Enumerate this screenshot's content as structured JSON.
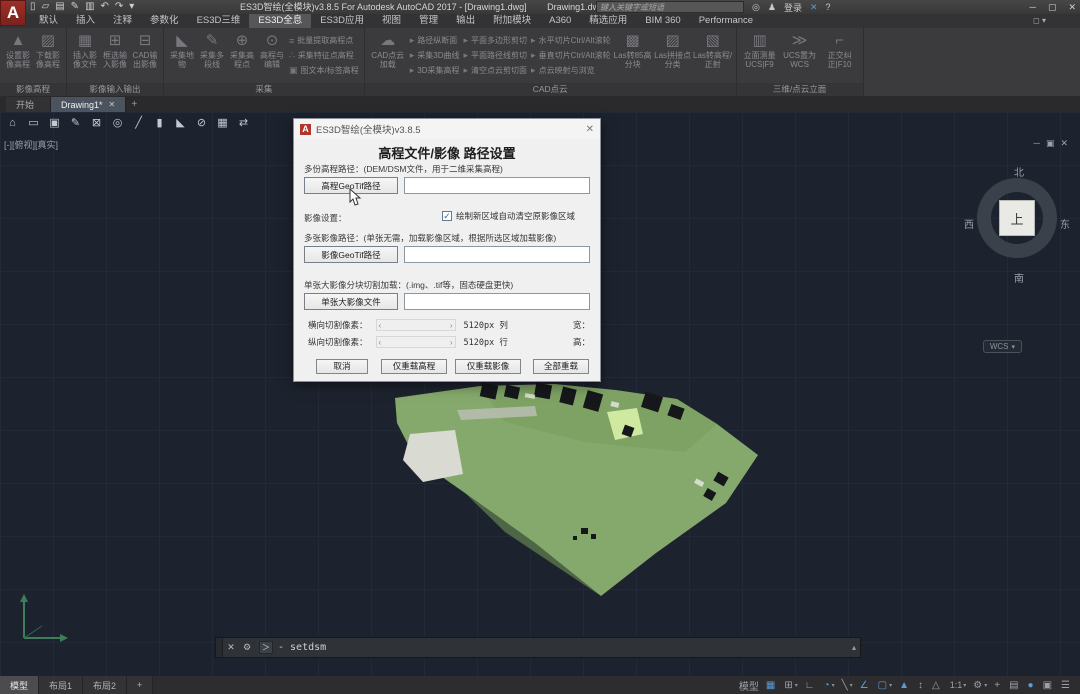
{
  "colors": {
    "canvas_bg": "#1d232e",
    "titlebar_bg": "#3a3a3c",
    "active_status": "#5b9bd8",
    "autocad_red": "#b2362c",
    "dialog_bg": "#f0f0f0"
  },
  "titlebar": {
    "app_title": "ES3D智绘(全模块)v3.8.5 For Autodesk AutoCAD 2017 - [Drawing1.dwg]",
    "doc_title": "Drawing1.dwg",
    "search_placeholder": "键入关键字或短语",
    "signin_label": "登录",
    "binoculars_glyph": "◎",
    "user_glyph": "♟",
    "exchange_glyph": "✕",
    "help_glyph": "?",
    "win_min": "─",
    "win_max": "▢",
    "win_close": "✕",
    "qat_icons": [
      {
        "name": "new-icon",
        "glyph": "▯"
      },
      {
        "name": "open-icon",
        "glyph": "▱"
      },
      {
        "name": "save-icon",
        "glyph": "▤"
      },
      {
        "name": "save-as-icon",
        "glyph": "✎"
      },
      {
        "name": "plot-icon",
        "glyph": "▥"
      },
      {
        "name": "undo-icon",
        "glyph": "↶"
      },
      {
        "name": "redo-icon",
        "glyph": "↷"
      },
      {
        "name": "qat-dropdown-icon",
        "glyph": "▾"
      }
    ]
  },
  "ribbon_tabs": {
    "items": [
      {
        "label": "默认"
      },
      {
        "label": "插入"
      },
      {
        "label": "注释"
      },
      {
        "label": "参数化"
      },
      {
        "label": "ES3D三维"
      },
      {
        "label": "ES3D全息",
        "active": true
      },
      {
        "label": "ES3D应用"
      },
      {
        "label": "视图"
      },
      {
        "label": "管理"
      },
      {
        "label": "输出"
      },
      {
        "label": "附加模块"
      },
      {
        "label": "A360"
      },
      {
        "label": "精选应用"
      },
      {
        "label": "BIM 360"
      },
      {
        "label": "Performance"
      }
    ],
    "toggle_glyph": "◻ ▾"
  },
  "ribbon": {
    "p1": {
      "label": "影像高程",
      "big": [
        {
          "name": "set-image-elevation",
          "glyph": "▲",
          "label": "设置影像高程"
        },
        {
          "name": "download-image-elevation",
          "glyph": "▨",
          "label": "下载影像高程"
        }
      ]
    },
    "p2": {
      "label": "影像输入输出",
      "big": [
        {
          "name": "insert-image-file",
          "glyph": "▦",
          "label": "插入影像文件"
        },
        {
          "name": "box-input-image",
          "glyph": "⊞",
          "label": "框选输入影像"
        },
        {
          "name": "cad-output-image",
          "glyph": "⊟",
          "label": "CAD输出影像"
        }
      ]
    },
    "p3": {
      "label": "采集",
      "big": [
        {
          "name": "collect-feature",
          "glyph": "◣",
          "label": "采集地物"
        },
        {
          "name": "collect-polyline",
          "glyph": "✎",
          "label": "采集多段线"
        },
        {
          "name": "collect-elevation-point",
          "glyph": "⊕",
          "label": "采集高程点"
        },
        {
          "name": "elevation-edit",
          "glyph": "⊙",
          "label": "高程与编辑"
        }
      ],
      "small": [
        {
          "name": "batch-extract-elevation",
          "glyph": "≡",
          "label": "批量提取高程点"
        },
        {
          "name": "collect-feature-elevation",
          "glyph": "∴",
          "label": "采集特征点高程"
        },
        {
          "name": "text-label-elevation",
          "glyph": "▣",
          "label": "图文本/标签高程"
        }
      ]
    },
    "p4": {
      "label": "CAD点云",
      "big": [
        {
          "name": "cad-pointcloud-load",
          "glyph": "☁",
          "label": "CAD点云加载"
        }
      ],
      "col1": [
        {
          "name": "path-profile",
          "glyph": "▸",
          "label": "路径纵断面"
        },
        {
          "name": "collect-3d-curve",
          "glyph": "▸",
          "label": "采集3D曲线"
        },
        {
          "name": "collect-3d-elevation",
          "glyph": "▸",
          "label": "3D采集高程"
        }
      ],
      "col2": [
        {
          "name": "plane-polygon-clip",
          "glyph": "▸",
          "label": "平面多边形剪切"
        },
        {
          "name": "plane-path-clip",
          "glyph": "▸",
          "label": "平面路径线剪切"
        },
        {
          "name": "clear-pointcloud-clip",
          "glyph": "▸",
          "label": "清空点云剪切面"
        }
      ],
      "col3": [
        {
          "name": "horizontal-slice",
          "glyph": "▸",
          "label": "水平切片Ctrl/Alt滚轮"
        },
        {
          "name": "vertical-slice",
          "glyph": "▸",
          "label": "垂直切片Ctrl/Alt滚轮"
        },
        {
          "name": "pointcloud-browse",
          "glyph": "▸",
          "label": "点云映射与浏览"
        }
      ],
      "big2": [
        {
          "name": "las-to-85-block",
          "glyph": "▩",
          "label": "Las转85高分块"
        },
        {
          "name": "las-merge-classify",
          "glyph": "▨",
          "label": "Las拼接点分类"
        },
        {
          "name": "las-to-ortho",
          "glyph": "▧",
          "label": "Las转高程/正射"
        }
      ]
    },
    "p5": {
      "label": "三维/点云立面",
      "big": [
        {
          "name": "facade-measure-ucs",
          "glyph": "▥",
          "label": "立面测量UCS|F9"
        },
        {
          "name": "ucs-to-wcs",
          "glyph": "≫",
          "label": "UCS置为WCS"
        },
        {
          "name": "ortho-correct",
          "glyph": "⌐",
          "label": "正交纠正|F10"
        }
      ]
    }
  },
  "file_tabs": {
    "items": [
      {
        "label": "开始"
      },
      {
        "label": "Drawing1*",
        "active": true,
        "close": "✕"
      }
    ],
    "add_label": "+"
  },
  "toolbar2": {
    "icons": [
      {
        "name": "home-icon",
        "glyph": "⌂"
      },
      {
        "name": "pan-icon",
        "glyph": "▭"
      },
      {
        "name": "viewport-icon",
        "glyph": "▣"
      },
      {
        "name": "hatch-icon",
        "glyph": "✎"
      },
      {
        "name": "region-icon",
        "glyph": "⊠"
      },
      {
        "name": "zoom-icon",
        "glyph": "◎"
      },
      {
        "name": "line-icon",
        "glyph": "╱"
      },
      {
        "name": "column-icon",
        "glyph": "▮"
      },
      {
        "name": "measure-icon",
        "glyph": "◣"
      },
      {
        "name": "ellipse-icon",
        "glyph": "⊘"
      },
      {
        "name": "table-icon",
        "glyph": "▦"
      },
      {
        "name": "sheet-icon",
        "glyph": "⇄"
      }
    ]
  },
  "viewport": {
    "label": "[-][俯视][真实]",
    "win_min": "─",
    "win_restore": "▣",
    "win_close": "✕"
  },
  "viewcube": {
    "north": "北",
    "south": "南",
    "west": "西",
    "east": "东",
    "center": "上",
    "wcs": "WCS",
    "wcs_dd": "▾"
  },
  "dialog": {
    "title": "ES3D智绘(全模块)v3.8.5",
    "close_glyph": "✕",
    "heading": "高程文件/影像 路径设置",
    "sec1_label": "多份高程路径：(DEM/DSM文件，用于二维采集高程)",
    "sec1_button": "高程GeoTif路径",
    "settings_label": "影像设置：",
    "checkbox_glyph": "✓",
    "checkbox_label": "绘制新区域自动清空原影像区域",
    "sec2_label": "多张影像路径：(单张无需，加载影像区域，根据所选区域加载影像)",
    "sec2_button": "影像GeoTif路径",
    "sec3_label": "单张大影像分块切割加载：(.img、.tif等，固态硬盘更快)",
    "sec3_button": "单张大影像文件",
    "row_h_label": "横向切割像素：",
    "row_h_value": "5120px 列",
    "row_h_right": "宽：",
    "row_v_label": "纵向切割像素：",
    "row_v_value": "5120px 行",
    "row_v_right": "高：",
    "spin_left": "‹",
    "spin_right": "›",
    "buttons": [
      {
        "name": "cancel-button",
        "label": "取消"
      },
      {
        "name": "reload-elevation-button",
        "label": "仅重载高程"
      },
      {
        "name": "reload-image-button",
        "label": "仅重载影像"
      },
      {
        "name": "reload-all-button",
        "label": "全部重载"
      }
    ]
  },
  "commandbar": {
    "close_glyph": "✕",
    "tools_glyph": "⚙",
    "prompt": "＞",
    "command": "- setdsm",
    "scroll_up": "▴"
  },
  "statusbar": {
    "tabs": [
      {
        "label": "模型",
        "active": true
      },
      {
        "label": "布局1"
      },
      {
        "label": "布局2"
      },
      {
        "label": "+"
      }
    ],
    "model_label": "模型",
    "icons": [
      {
        "name": "grid-icon",
        "glyph": "▦",
        "active": true
      },
      {
        "name": "snap-icon",
        "glyph": "⊞",
        "dd": "▾"
      },
      {
        "name": "infer-constraints-icon",
        "glyph": "∟"
      },
      {
        "name": "polar-tracking-icon",
        "glyph": "◔",
        "dd": "▾",
        "active": true
      },
      {
        "name": "isodraft-icon",
        "glyph": "╲",
        "dd": "▾"
      },
      {
        "name": "osnap-tracking-icon",
        "glyph": "∠",
        "active": true
      },
      {
        "name": "osnap-icon",
        "glyph": "▢",
        "dd": "▾",
        "active": true
      },
      {
        "name": "annotation-visibility-icon",
        "glyph": "▲",
        "active": true
      },
      {
        "name": "annotation-autoscale-icon",
        "glyph": "↕"
      },
      {
        "name": "annotation-scale-icon",
        "glyph": "△"
      },
      {
        "name": "annotation-scale-value",
        "label": "1:1",
        "dd": "▾"
      },
      {
        "name": "workspace-gear-icon",
        "glyph": "⚙",
        "dd": "▾"
      },
      {
        "name": "annotation-monitor-icon",
        "glyph": "+"
      },
      {
        "name": "quick-properties-icon",
        "glyph": "▤"
      },
      {
        "name": "graphics-performance-icon",
        "glyph": "●",
        "active": true
      },
      {
        "name": "clean-screen-icon",
        "glyph": "▣"
      },
      {
        "name": "customize-icon",
        "glyph": "☰"
      }
    ]
  }
}
